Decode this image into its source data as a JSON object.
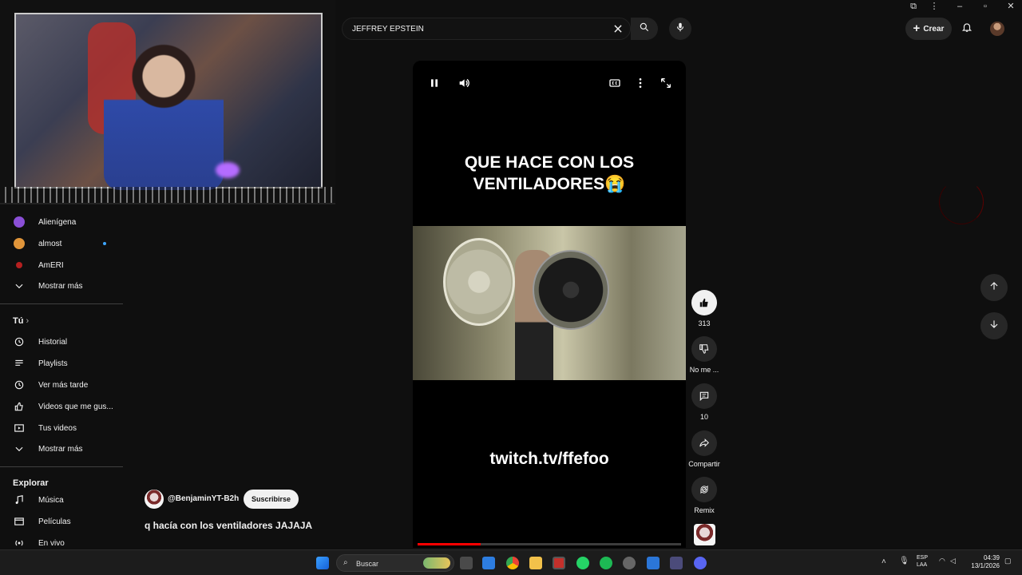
{
  "search": {
    "query": "JEFFREY EPSTEIN"
  },
  "header": {
    "create_label": "Crear"
  },
  "sidebar": {
    "subscriptions": [
      {
        "label": "Alienígena",
        "color": "#8a4fd6"
      },
      {
        "label": "almost",
        "color": "#e0953a"
      },
      {
        "label": "AmERI",
        "color": "#b52020"
      }
    ],
    "show_more": "Mostrar más",
    "you_heading": "Tú",
    "you_items": [
      {
        "label": "Historial",
        "icon": "history-icon"
      },
      {
        "label": "Playlists",
        "icon": "playlists-icon"
      },
      {
        "label": "Ver más tarde",
        "icon": "watch-later-icon"
      },
      {
        "label": "Videos que me gus...",
        "icon": "liked-videos-icon"
      },
      {
        "label": "Tus videos",
        "icon": "your-videos-icon"
      }
    ],
    "show_more_2": "Mostrar más",
    "explore_heading": "Explorar",
    "explore_items": [
      {
        "label": "Música",
        "icon": "music-icon"
      },
      {
        "label": "Películas",
        "icon": "movies-icon"
      },
      {
        "label": "En vivo",
        "icon": "live-icon"
      }
    ]
  },
  "short": {
    "headline_line1": "QUE HACE CON LOS",
    "headline_line2": "VENTILADORES😭",
    "overlay_url": "twitch.tv/ffefoo",
    "progress": 0.24,
    "channel": "@BenjaminYT-B2h",
    "subscribe_label": "Suscribirse",
    "caption": "q hacía con los ventiladores JAJAJA"
  },
  "actions": {
    "likes": "313",
    "dislike_label": "No me ...",
    "comments": "10",
    "share_label": "Compartir",
    "remix_label": "Remix"
  },
  "taskbar": {
    "search_placeholder": "Buscar",
    "lang_line1": "ESP",
    "lang_line2": "LAA",
    "time": "04:39",
    "date": "13/1/2026"
  }
}
